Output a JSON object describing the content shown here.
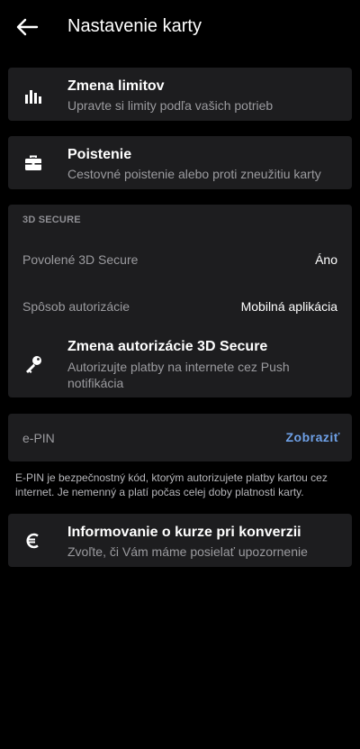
{
  "header": {
    "title": "Nastavenie karty",
    "back_icon": "arrow-left-icon"
  },
  "limits": {
    "title": "Zmena limitov",
    "subtitle": "Upravte si limity podľa vašich potrieb",
    "icon": "bar-chart-icon"
  },
  "insurance": {
    "title": "Poistenie",
    "subtitle": "Cestovné poistenie alebo proti zneužitiu karty",
    "icon": "briefcase-icon"
  },
  "secure3d": {
    "section_title": "3D SECURE",
    "enabled_label": "Povolené 3D Secure",
    "enabled_value": "Áno",
    "auth_label": "Spôsob autorizácie",
    "auth_value": "Mobilná aplikácia",
    "change_title": "Zmena autorizácie 3D Secure",
    "change_subtitle": "Autorizujte platby na internete cez Push notifikácia",
    "icon": "key-icon"
  },
  "epin": {
    "label": "e-PIN",
    "action": "Zobraziť",
    "note": "E-PIN je bezpečnostný kód, ktorým autorizujete platby kartou cez internet. Je nemenný a platí počas celej doby platnosti karty."
  },
  "conversion": {
    "title": "Informovanie o kurze pri konverzii",
    "subtitle": "Zvoľte, či Vám máme posielať upozornenie",
    "icon": "euro-icon"
  },
  "colors": {
    "background": "#000000",
    "card": "#1d1d1f",
    "accent": "#6ea0e6",
    "secondary_text": "#9b9b9f"
  }
}
